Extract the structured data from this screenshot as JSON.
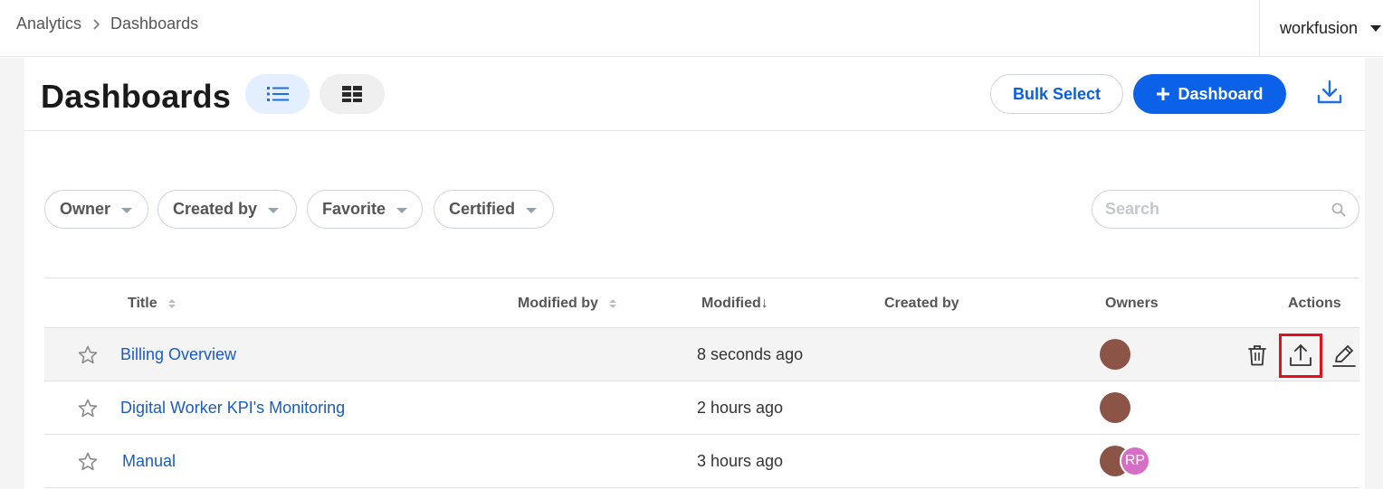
{
  "breadcrumb": {
    "root": "Analytics",
    "current": "Dashboards"
  },
  "tenant": {
    "name": "workfusion"
  },
  "page": {
    "title": "Dashboards"
  },
  "toolbar": {
    "bulk_select": "Bulk Select",
    "new_dashboard": "Dashboard"
  },
  "filters": {
    "owner": "Owner",
    "created_by": "Created by",
    "favorite": "Favorite",
    "certified": "Certified"
  },
  "search": {
    "placeholder": "Search",
    "value": ""
  },
  "table": {
    "columns": {
      "title": "Title",
      "modified_by": "Modified by",
      "modified": "Modified↓",
      "created_by": "Created by",
      "owners": "Owners",
      "actions": "Actions"
    },
    "rows": [
      {
        "title": "Billing Overview",
        "modified_by": "",
        "modified": "8 seconds ago",
        "created_by": "",
        "owners": [
          ""
        ]
      },
      {
        "title": "Digital Worker KPI's Monitoring",
        "modified_by": "",
        "modified": "2 hours ago",
        "created_by": "",
        "owners": [
          ""
        ]
      },
      {
        "title": "Manual",
        "modified_by": "",
        "modified": "3 hours ago",
        "created_by": "",
        "owners": [
          "",
          "RP"
        ]
      }
    ]
  },
  "colors": {
    "accent": "#0b62e8",
    "link": "#1a5bc4",
    "highlight": "#e3101c",
    "avatar_brown": "#8b5446",
    "avatar_pink": "#d76ec6"
  }
}
